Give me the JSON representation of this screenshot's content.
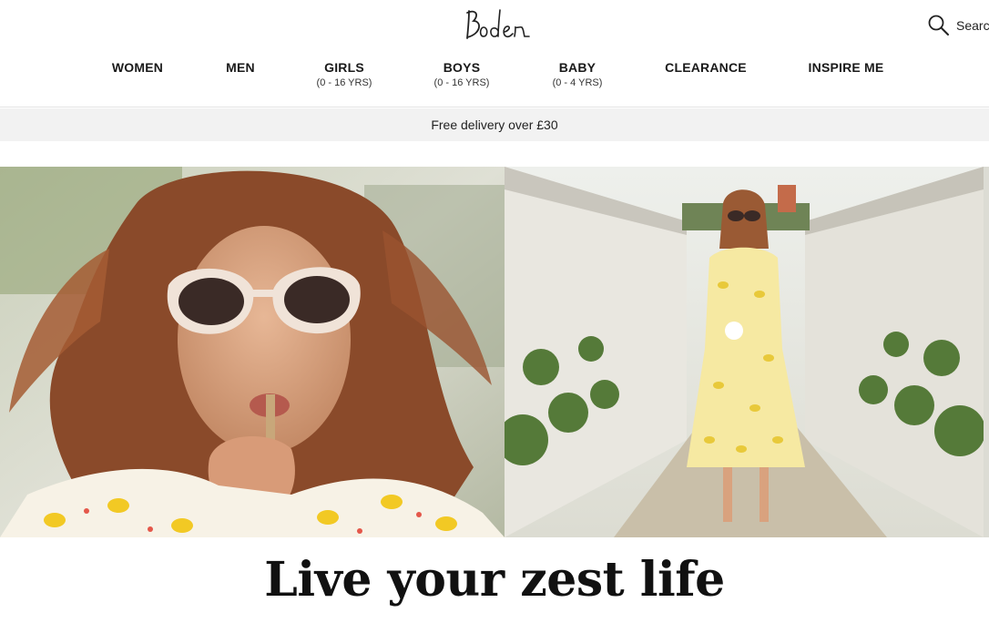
{
  "brand": {
    "logo_text": "Boden"
  },
  "search": {
    "label": "Search",
    "icon": "search-icon"
  },
  "nav": [
    {
      "label": "WOMEN",
      "sub": ""
    },
    {
      "label": "MEN",
      "sub": ""
    },
    {
      "label": "GIRLS",
      "sub": "(0 - 16 YRS)"
    },
    {
      "label": "BOYS",
      "sub": "(0 - 16 YRS)"
    },
    {
      "label": "BABY",
      "sub": "(0 - 4 YRS)"
    },
    {
      "label": "CLEARANCE",
      "sub": ""
    },
    {
      "label": "INSPIRE ME",
      "sub": ""
    }
  ],
  "promo": {
    "text": "Free delivery over £30"
  },
  "hero": {
    "images": [
      {
        "name": "woman-drinking-lemonade"
      },
      {
        "name": "woman-in-lemon-print-dress"
      }
    ],
    "headline": "Live your zest life"
  },
  "colors": {
    "promo_bg": "#f2f2f2",
    "dress_yellow": "#e8c93a",
    "text": "#1a1a1a"
  }
}
